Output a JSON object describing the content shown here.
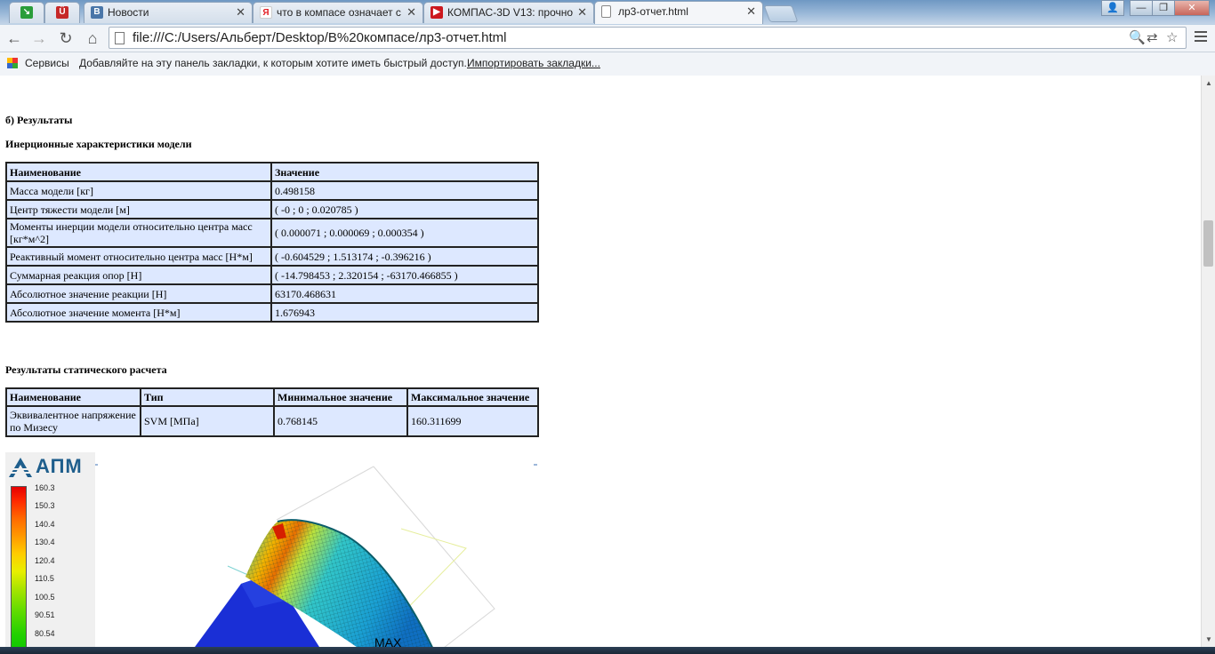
{
  "browser": {
    "tabs": [
      {
        "label": "",
        "icon": "green-arrow-icon",
        "icon_color": "#2a9d3a"
      },
      {
        "label": "",
        "icon": "mouse-icon",
        "icon_color": "#c62828"
      },
      {
        "label": "Новости",
        "icon": "vk-icon",
        "icon_color": "#4a76a8"
      },
      {
        "label": "что в компасе означает с",
        "icon": "yandex-icon",
        "icon_color": "#e31e24"
      },
      {
        "label": "КОМПАС-3D V13: прочно",
        "icon": "youtube-icon",
        "icon_color": "#cc181e"
      },
      {
        "label": "лр3-отчет.html",
        "icon": "page-icon",
        "icon_color": "#ffffff",
        "active": true
      }
    ],
    "address": "file:///C:/Users/Альберт/Desktop/В%20компасе/лр3-отчет.html",
    "bookmarks": {
      "apps_label": "Сервисы",
      "hint": "Добавляйте на эту панель закладки, к которым хотите иметь быстрый доступ.",
      "import_link": "Импортировать закладки..."
    }
  },
  "report": {
    "section_heading": "б) Результаты",
    "inertia": {
      "heading": "Инерционные характеристики модели",
      "columns": [
        "Наименование",
        "Значение"
      ],
      "rows": [
        [
          "Масса модели [кг]",
          "0.498158"
        ],
        [
          "Центр тяжести модели [м]",
          "( -0 ; 0 ; 0.020785 )"
        ],
        [
          "Моменты инерции модели относительно центра масс [кг*м^2]",
          "( 0.000071 ; 0.000069 ; 0.000354 )"
        ],
        [
          "Реактивный момент относительно центра масс [Н*м]",
          "( -0.604529 ; 1.513174 ; -0.396216 )"
        ],
        [
          "Суммарная реакция опор [Н]",
          "( -14.798453 ; 2.320154 ; -63170.466855 )"
        ],
        [
          "Абсолютное значение реакции [Н]",
          "63170.468631"
        ],
        [
          "Абсолютное значение момента [Н*м]",
          "1.676943"
        ]
      ]
    },
    "static": {
      "heading": "Результаты статического расчета",
      "columns": [
        "Наименование",
        "Тип",
        "Минимальное значение",
        "Максимальное значение"
      ],
      "rows": [
        [
          "Эквивалентное напряжение по Мизесу",
          "SVM [МПа]",
          "0.768145",
          "160.311699"
        ]
      ]
    },
    "figure": {
      "logo": "АПМ",
      "legend_values": [
        "160.3",
        "150.3",
        "140.4",
        "130.4",
        "120.4",
        "110.5",
        "100.5",
        "90.51",
        "80.54"
      ],
      "max_label": "MAX"
    }
  }
}
